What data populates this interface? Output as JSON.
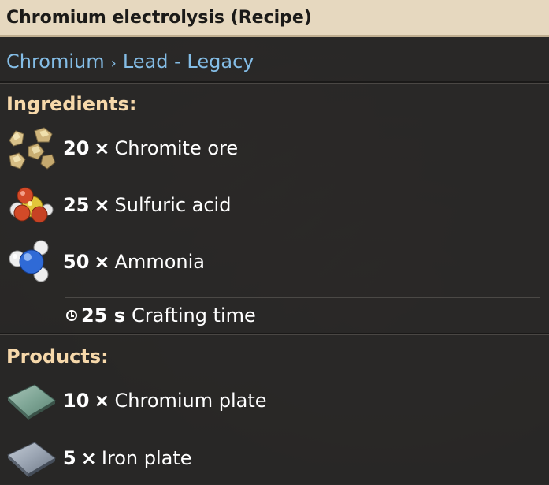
{
  "title": "Chromium electrolysis (Recipe)",
  "subtitle": {
    "primary": "Chromium",
    "separator": "›",
    "secondary": "Lead - Legacy"
  },
  "ingredients": {
    "header": "Ingredients:",
    "items": [
      {
        "amount": "20",
        "times": "×",
        "name": "Chromite ore",
        "icon": "chromite-ore-icon"
      },
      {
        "amount": "25",
        "times": "×",
        "name": "Sulfuric acid",
        "icon": "sulfuric-acid-icon"
      },
      {
        "amount": "50",
        "times": "×",
        "name": "Ammonia",
        "icon": "ammonia-icon"
      }
    ]
  },
  "crafting": {
    "time": "25 s",
    "label": "Crafting time",
    "icon": "clock-icon"
  },
  "products": {
    "header": "Products:",
    "items": [
      {
        "amount": "10",
        "times": "×",
        "name": "Chromium plate",
        "icon": "chromium-plate-icon"
      },
      {
        "amount": "5",
        "times": "×",
        "name": "Iron plate",
        "icon": "iron-plate-icon"
      }
    ]
  },
  "colors": {
    "title_bg": "#e6d8bf",
    "subtitle": "#84bde6",
    "section_header": "#f6d8aa",
    "text": "#ffffff"
  }
}
